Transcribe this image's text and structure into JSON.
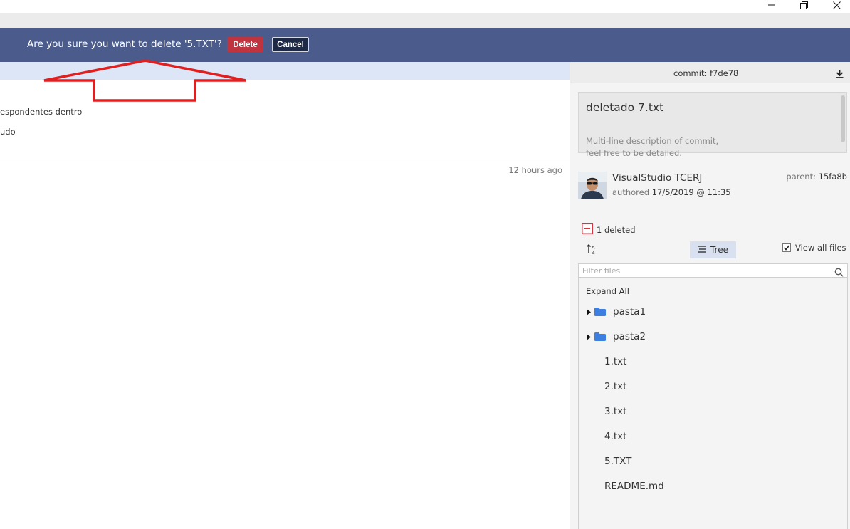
{
  "banner": {
    "message": "Are you sure you want to delete '5.TXT'?",
    "delete_label": "Delete",
    "cancel_label": "Cancel"
  },
  "history": {
    "line1": "espondentes dentro",
    "line2": "udo",
    "time_ago": "12 hours ago"
  },
  "commit": {
    "label": "commit: f7de78",
    "title": "deletado 7.txt",
    "description_line1": "Multi-line description of commit,",
    "description_line2": "feel free to be detailed.",
    "author": "VisualStudio TCERJ",
    "authored_label": "authored",
    "authored_date": "17/5/2019 @ 11:35",
    "parent_label": "parent:",
    "parent_hash": "15fa8b"
  },
  "changes": {
    "deleted_label": "1 deleted"
  },
  "file_tools": {
    "tree_label": "Tree",
    "view_all_label": "View all files",
    "view_all_checked": true,
    "filter_placeholder": "Filter files"
  },
  "tree": {
    "expand_all": "Expand All",
    "folders": [
      {
        "label": "pasta1"
      },
      {
        "label": "pasta2"
      }
    ],
    "files": [
      {
        "label": "1.txt"
      },
      {
        "label": "2.txt"
      },
      {
        "label": "3.txt"
      },
      {
        "label": "4.txt"
      },
      {
        "label": "5.TXT"
      },
      {
        "label": "README.md"
      }
    ]
  },
  "colors": {
    "banner_bg": "#4a5b8c",
    "delete_red": "#c0343f",
    "annotation_red": "#e02020",
    "folder_blue": "#3d7fe0"
  }
}
